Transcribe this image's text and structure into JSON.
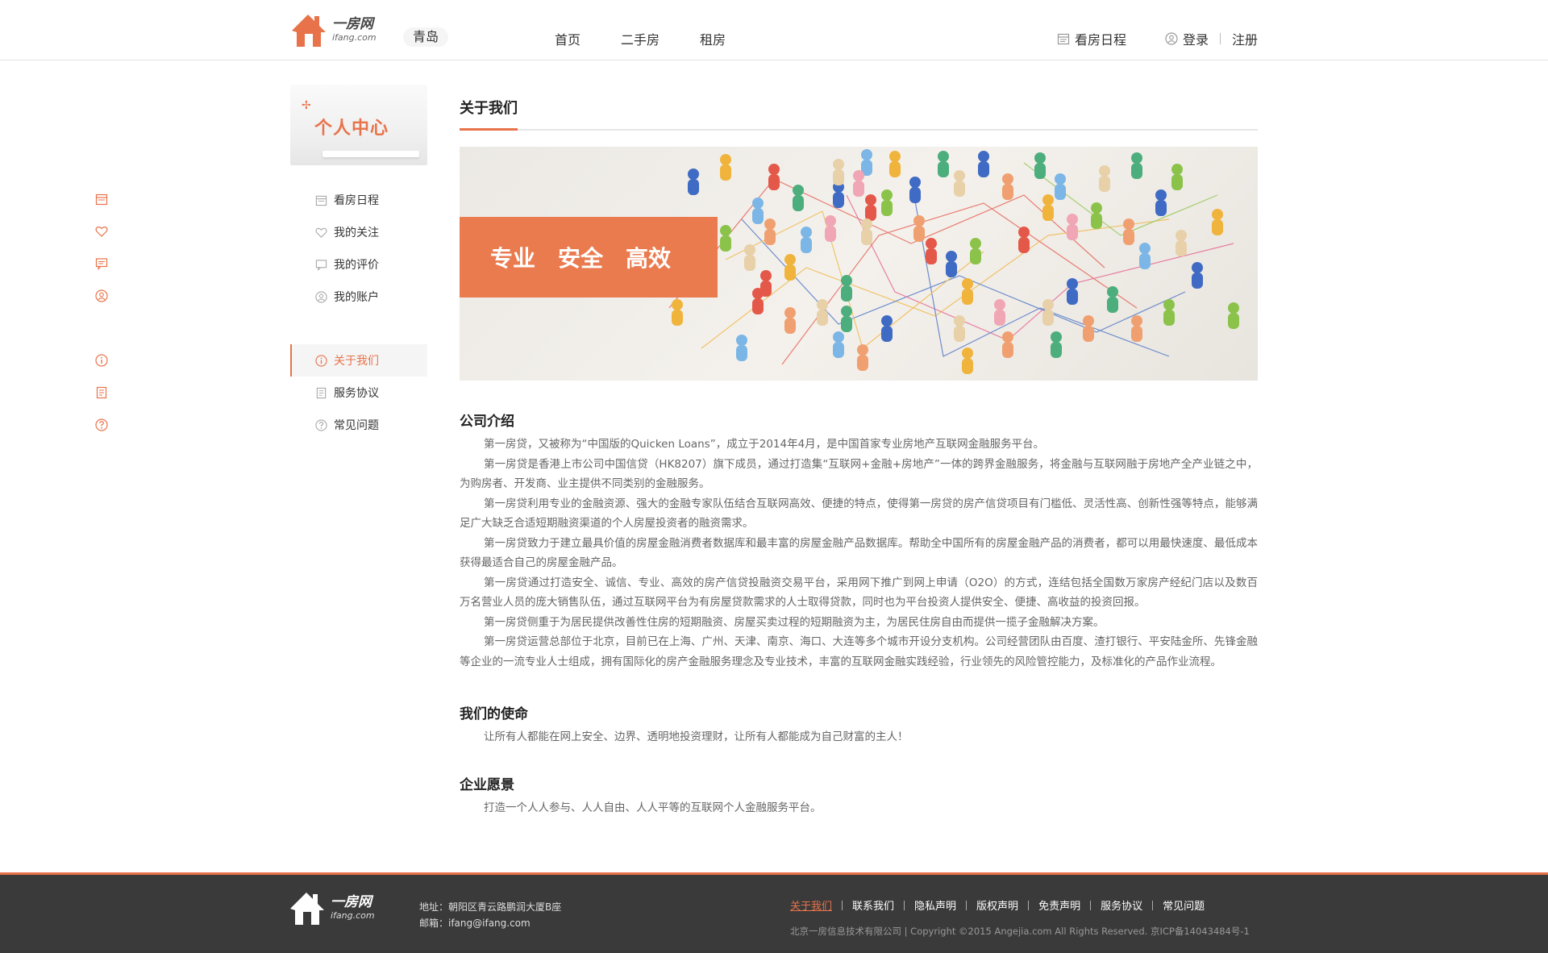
{
  "header": {
    "logo_cn": "一房网",
    "logo_en": "ifang.com",
    "city": "青岛",
    "nav": [
      "首页",
      "二手房",
      "租房"
    ],
    "schedule": "看房日程",
    "login": "登录",
    "register": "注册"
  },
  "sidebar": {
    "banner_title": "个人中心",
    "group1": [
      {
        "label": "看房日程",
        "icon": "calendar-icon"
      },
      {
        "label": "我的关注",
        "icon": "heart-icon"
      },
      {
        "label": "我的评价",
        "icon": "comment-icon"
      },
      {
        "label": "我的账户",
        "icon": "user-icon"
      }
    ],
    "group2": [
      {
        "label": "关于我们",
        "icon": "info-icon",
        "active": true
      },
      {
        "label": "服务协议",
        "icon": "document-icon"
      },
      {
        "label": "常见问题",
        "icon": "question-icon"
      }
    ]
  },
  "main": {
    "title": "关于我们",
    "hero_words": [
      "专业",
      "安全",
      "高效"
    ],
    "sections": [
      {
        "heading": "公司介绍",
        "paragraphs": [
          "第一房贷，又被称为“中国版的Quicken Loans”，成立于2014年4月，是中国首家专业房地产互联网金融服务平台。",
          "第一房贷是香港上市公司中国信贷（HK8207）旗下成员，通过打造集“互联网+金融+房地产”一体的跨界金融服务，将金融与互联网融于房地产全产业链之中，为购房者、开发商、业主提供不同类别的金融服务。",
          "第一房贷利用专业的金融资源、强大的金融专家队伍结合互联网高效、便捷的特点，使得第一房贷的房产信贷项目有门槛低、灵活性高、创新性强等特点，能够满足广大缺乏合适短期融资渠道的个人房屋投资者的融资需求。",
          "第一房贷致力于建立最具价值的房屋金融消费者数据库和最丰富的房屋金融产品数据库。帮助全中国所有的房屋金融产品的消费者，都可以用最快速度、最低成本获得最适合自己的房屋金融产品。",
          "第一房贷通过打造安全、诚信、专业、高效的房产信贷投融资交易平台，采用网下推广到网上申请（O2O）的方式，连结包括全国数万家房产经纪门店以及数百万名营业人员的庞大销售队伍，通过互联网平台为有房屋贷款需求的人士取得贷款，同时也为平台投资人提供安全、便捷、高收益的投资回报。",
          "第一房贷侧重于为居民提供改善性住房的短期融资、房屋买卖过程的短期融资为主，为居民住房自由而提供一揽子金融解决方案。",
          "第一房贷运营总部位于北京，目前已在上海、广州、天津、南京、海口、大连等多个城市开设分支机构。公司经营团队由百度、渣打银行、平安陆金所、先锋金融等企业的一流专业人士组成，拥有国际化的房产金融服务理念及专业技术，丰富的互联网金融实践经验，行业领先的风险管控能力，及标准化的产品作业流程。"
        ]
      },
      {
        "heading": "我们的使命",
        "paragraphs": [
          "让所有人都能在网上安全、边界、透明地投资理财，让所有人都能成为自己财富的主人！"
        ]
      },
      {
        "heading": "企业愿景",
        "paragraphs": [
          "打造一个人人参与、人人自由、人人平等的互联网个人金融服务平台。"
        ]
      }
    ]
  },
  "footer": {
    "logo_cn": "一房网",
    "logo_en": "ifang.com",
    "address": "地址：朝阳区青云路鹏润大厦B座",
    "email": "邮箱：ifang@ifang.com",
    "links": [
      "关于我们",
      "联系我们",
      "隐私声明",
      "版权声明",
      "免责声明",
      "服务协议",
      "常见问题"
    ],
    "copyright": "北京一房信息技术有限公司 | Copyright ©2015 Angejia.com All Rights Reserved. 京ICP备14043484号-1"
  },
  "colors": {
    "accent": "#e8734a",
    "footer_bg": "#3a3a3a"
  }
}
